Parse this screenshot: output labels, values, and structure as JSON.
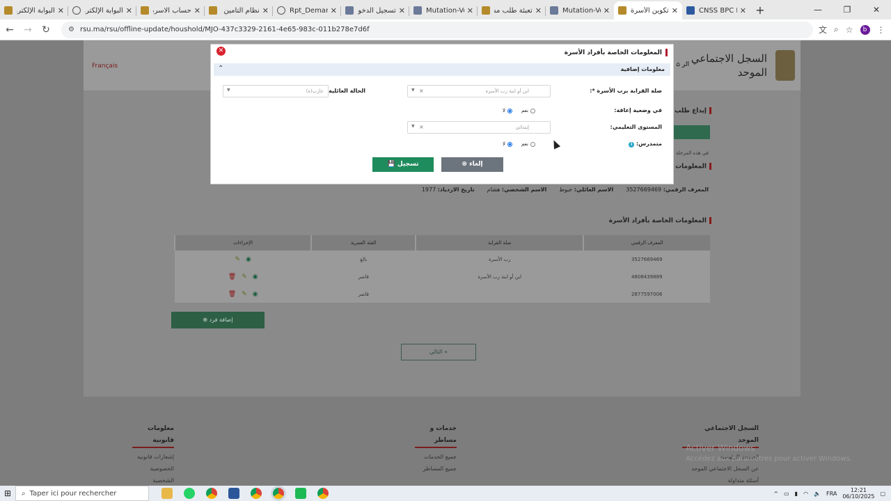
{
  "browser": {
    "tabs": [
      {
        "label": "البوابة الإلكترونية",
        "icon": "emblem-icon"
      },
      {
        "label": "البوابة الإلكترونية",
        "icon": "globe-icon"
      },
      {
        "label": "حساب الاسرة",
        "icon": "emblem-icon"
      },
      {
        "label": "نظام التأمين الإ",
        "icon": "emblem-icon"
      },
      {
        "label": "Rpt_Demande",
        "icon": "globe-icon"
      },
      {
        "label": "تسجيل الدخول",
        "icon": "doc-icon"
      },
      {
        "label": "Mutation-Vehi",
        "icon": "doc-icon"
      },
      {
        "label": "تعبئة طلب مسـ",
        "icon": "emblem-icon"
      },
      {
        "label": "Mutation-Vehi",
        "icon": "doc-icon"
      },
      {
        "label": "تكوين الأسرة",
        "icon": "emblem-icon",
        "active": true
      },
      {
        "label": "CNSS BPC Pay",
        "icon": "cnss-icon"
      }
    ],
    "url": "rsu.ma/rsu/offline-update/houshold/MJO-437c3329-2161-4e65-983c-011b278e7d6f",
    "profile_initial": "b"
  },
  "site": {
    "lang_link": "Français",
    "logo_text_line1": "السجل الاجتماعي",
    "logo_text_line2": "الموحد",
    "home_label": "الر"
  },
  "page": {
    "request_heading": "إيداع طلب تحيين",
    "section_member_info": "المعلومات الخاصة بأفراد الأسرة",
    "section_head_info": "المعلومات الخا",
    "hint_text": "في هذه المرحلة",
    "head_summary": {
      "id_label": "المعرف الرقمي:",
      "id_value": "3527669469",
      "family_label": "الاسم العائلي:",
      "family_value": "خيوط",
      "first_label": "الاسم الشخصي:",
      "first_value": "هشام",
      "dob_label": "تاريخ الازدياد:",
      "dob_value": "1977"
    },
    "table": {
      "headers": [
        "المعرف الرقمي",
        "صلة القرابة",
        "الفئة العمرية",
        "الإجراءات"
      ],
      "rows": [
        {
          "id": "3527669469",
          "relation": "رب الأسرة",
          "age": "بالغ",
          "delete": false
        },
        {
          "id": "4808439889",
          "relation": "ابن أو ابنة رب الأسرة",
          "age": "قاصر",
          "delete": true
        },
        {
          "id": "2877597006",
          "relation": "",
          "age": "قاصر",
          "delete": true
        }
      ]
    },
    "add_member_label": "إضافة فرد",
    "next_label": "التالي"
  },
  "footer": {
    "col1_title": "معلومات قانونية",
    "col1_items": [
      "إشعارات قانونية",
      "الخصوصية الشخصية"
    ],
    "col2_title": "خدمات و مساطر",
    "col2_items": [
      "جميع الخدمات",
      "جميع المساطر"
    ],
    "col3_title": "السجل الاجتماعي الموحد",
    "col3_items": [
      "الصفحة الرئيسية",
      "عن السجل الاجتماعي الموحد",
      "أسئلة متداولة"
    ],
    "watermark_title": "Activer Windows",
    "watermark_sub": "Accédez aux paramètres pour activer Windows."
  },
  "modal": {
    "title": "المعلومات الخاصة بأفراد الأسرة",
    "subsection": "معلومات إضافية",
    "relation_label": "صلة القرابة برب الأسرة *:",
    "relation_value": "ابن أو ابنة رب الأسرة",
    "marital_label": "الحالة العائلية *:",
    "marital_value": "عازب(ة)",
    "disability_label": "في وضعية إعاقة:",
    "education_label": "المستوى التعليمي:",
    "education_value": "إبتدائي",
    "schooled_label": "متمدرس:",
    "yes": "نعم",
    "no": "لا",
    "save_label": "تسجيل",
    "cancel_label": "إلغاء"
  },
  "taskbar": {
    "search_placeholder": "Taper ici pour rechercher",
    "lang": "FRA",
    "time": "12:21",
    "date": "06/10/2025"
  }
}
